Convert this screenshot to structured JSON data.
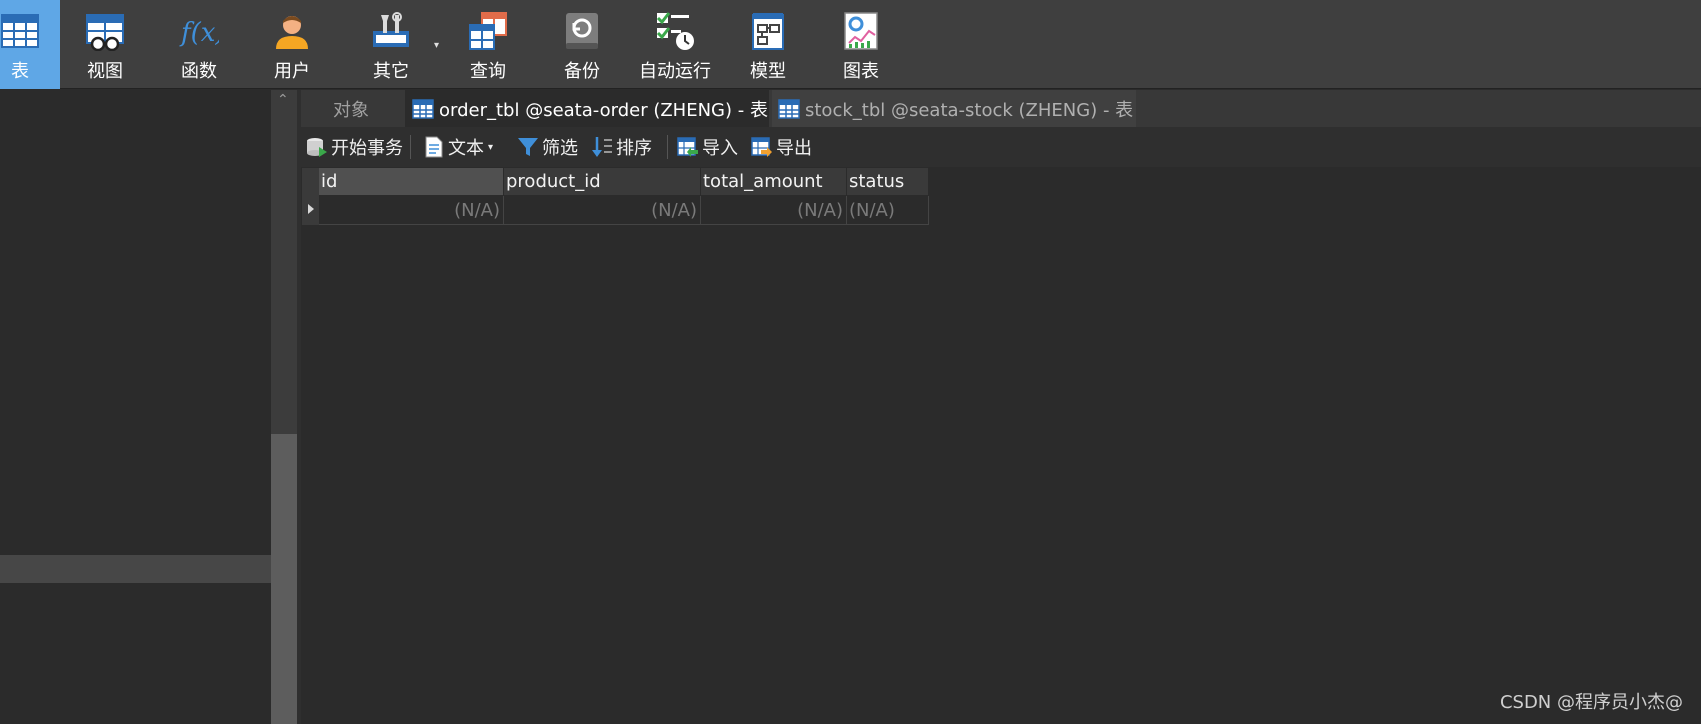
{
  "toolbar": {
    "buttons": [
      {
        "label": "表",
        "icon": "table-icon",
        "active": true
      },
      {
        "label": "视图",
        "icon": "view-icon"
      },
      {
        "label": "函数",
        "icon": "function-icon"
      },
      {
        "label": "用户",
        "icon": "user-icon"
      },
      {
        "label": "其它",
        "icon": "tools-icon"
      },
      {
        "label": "查询",
        "icon": "query-icon"
      },
      {
        "label": "备份",
        "icon": "backup-icon"
      },
      {
        "label": "自动运行",
        "icon": "schedule-icon"
      },
      {
        "label": "模型",
        "icon": "model-icon"
      },
      {
        "label": "图表",
        "icon": "chart-icon"
      }
    ],
    "function_glyph": "f(x)",
    "dropdown_glyph": "▾"
  },
  "tabs": {
    "objects": "对象",
    "order": "order_tbl @seata-order (ZHENG) - 表",
    "stock": "stock_tbl @seata-stock (ZHENG) - 表"
  },
  "datatoolbar": {
    "begin_transaction": "开始事务",
    "text": "文本",
    "filter": "筛选",
    "sort": "排序",
    "import": "导入",
    "export": "导出",
    "dropdown_glyph": "▾"
  },
  "grid": {
    "columns": [
      "id",
      "product_id",
      "total_amount",
      "status"
    ],
    "rows": [
      [
        "(N/A)",
        "(N/A)",
        "(N/A)",
        "(N/A)"
      ]
    ]
  },
  "scroll": {
    "up_glyph": "⌃"
  },
  "watermark": "CSDN @程序员小杰@",
  "colors": {
    "accent": "#5fa7e6",
    "toolbar_bg": "#3f3f3f",
    "panel_bg": "#2b2b2b"
  }
}
